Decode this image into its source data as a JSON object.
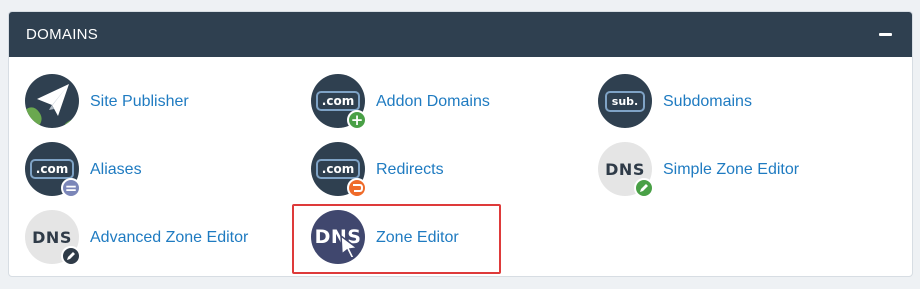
{
  "panel": {
    "title": "DOMAINS",
    "collapse_symbol": "−"
  },
  "items": [
    {
      "label": "Site Publisher",
      "icon": "paper-plane-globe-icon"
    },
    {
      "label": "Addon Domains",
      "icon": "com-add-icon",
      "badge": "plus"
    },
    {
      "label": "Subdomains",
      "icon": "sub-domain-icon"
    },
    {
      "label": "Aliases",
      "icon": "com-alias-icon",
      "badge": "equals"
    },
    {
      "label": "Redirects",
      "icon": "com-redirect-icon",
      "badge": "redirect-arrow"
    },
    {
      "label": "Simple Zone Editor",
      "icon": "dns-pencil-icon",
      "badge": "pencil"
    },
    {
      "label": "Advanced Zone Editor",
      "icon": "dns-pencil-icon",
      "badge": "pencil"
    },
    {
      "label": "Zone Editor",
      "icon": "dns-cursor-icon",
      "highlighted": true
    }
  ],
  "icon_text": {
    "com": ".com",
    "sub": "sub.",
    "dns": "DNS"
  },
  "colors": {
    "header_bg": "#2f4050",
    "link": "#1f7bc1",
    "highlight": "#de3a3a",
    "badge_green": "#49a046",
    "badge_orange": "#ef6b2a"
  }
}
